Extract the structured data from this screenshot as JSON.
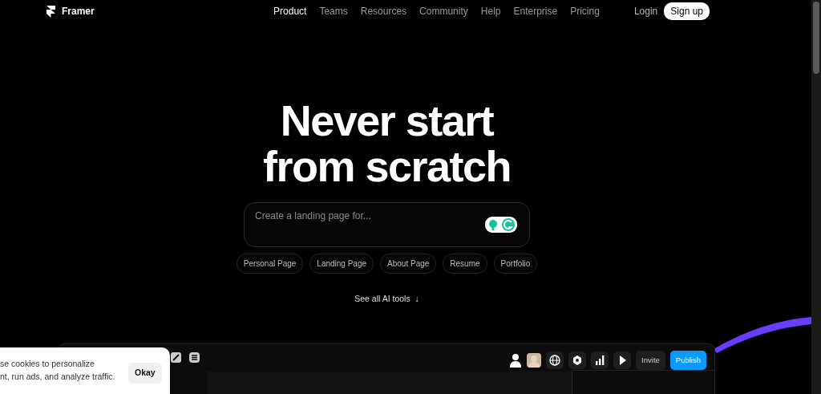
{
  "brand": {
    "name": "Framer"
  },
  "nav": [
    {
      "label": "Product",
      "selected": true
    },
    {
      "label": "Teams",
      "selected": false
    },
    {
      "label": "Resources",
      "selected": false
    },
    {
      "label": "Community",
      "selected": false
    },
    {
      "label": "Help",
      "selected": false
    },
    {
      "label": "Enterprise",
      "selected": false
    },
    {
      "label": "Pricing",
      "selected": false
    }
  ],
  "auth": {
    "login": "Login",
    "signup": "Sign up"
  },
  "hero": {
    "title_lines": [
      "Never start",
      "from scratch"
    ]
  },
  "prompt": {
    "placeholder": "Create a landing page for..."
  },
  "chips": [
    "Personal Page",
    "Landing Page",
    "About Page",
    "Resume",
    "Portfolio"
  ],
  "see_all": {
    "label": "See all AI tools",
    "arrow": "↓"
  },
  "editor": {
    "invite": "Invite",
    "publish": "Publish"
  },
  "cookie": {
    "text": "se cookies to personalize\nnt, run ads, and analyze traffic.",
    "button": "Okay"
  }
}
